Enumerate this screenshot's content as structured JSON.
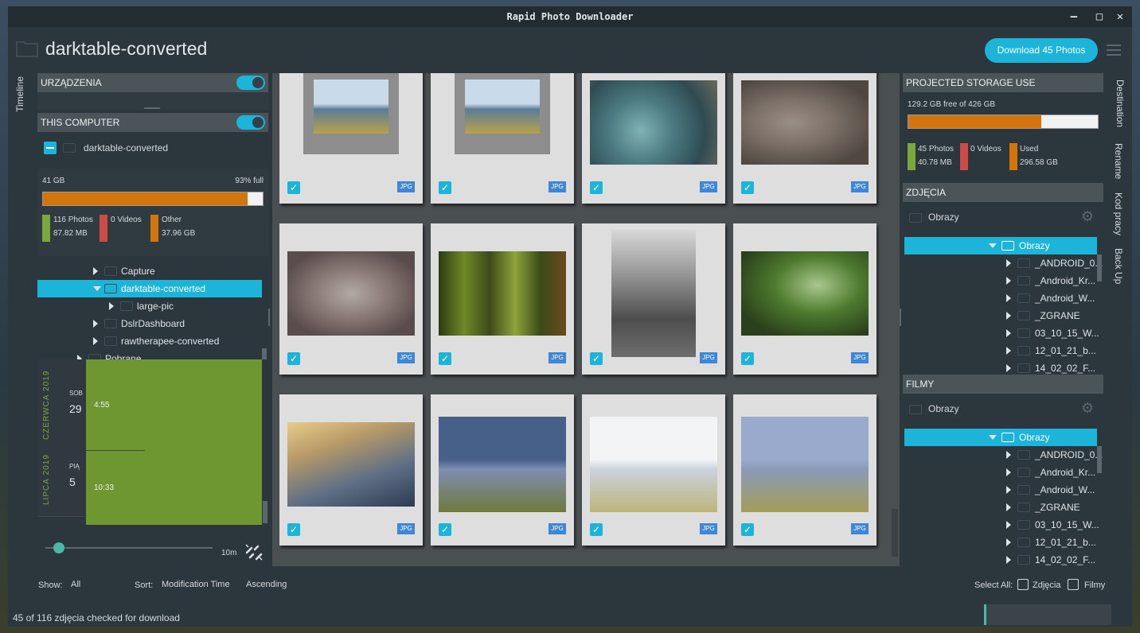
{
  "window": {
    "title": "Rapid Photo Downloader"
  },
  "header": {
    "title": "darktable-converted",
    "download_button": "Download 45 Photos"
  },
  "left_tabs": {
    "timeline": "Timeline"
  },
  "devices": {
    "label": "URZĄDZENIA"
  },
  "this_computer": {
    "label": "THIS COMPUTER",
    "folder": "darktable-converted",
    "storage_size": "41 GB",
    "storage_full": "93% full",
    "used_fraction": 0.93,
    "legend": [
      {
        "label": "116 Photos",
        "value": "87.82 MB",
        "color": "#7aa83d"
      },
      {
        "label": "0 Videos",
        "value": "",
        "color": "#cc4b46"
      },
      {
        "label": "Other",
        "value": "37.96 GB",
        "color": "#d4740d"
      }
    ],
    "tree": [
      {
        "label": "Capture",
        "selected": false
      },
      {
        "label": "darktable-converted",
        "selected": true
      },
      {
        "label": "large-pic",
        "selected": false
      },
      {
        "label": "DslrDashboard",
        "selected": false
      },
      {
        "label": "rawtherapee-converted",
        "selected": false
      },
      {
        "label": "Pobrane",
        "selected": false
      }
    ]
  },
  "timeline": {
    "groups": [
      {
        "month": "CZERWCA",
        "year": "2019",
        "weekday": "SOB",
        "day": "29",
        "time": "4:55"
      },
      {
        "month": "LIPCA",
        "year": "2019",
        "weekday": "PIĄ",
        "day": "5",
        "time": "10:33"
      }
    ],
    "slider_value": "10m"
  },
  "thumbnails": [
    {
      "type": "JPG",
      "checked": true
    },
    {
      "type": "JPG",
      "checked": true
    },
    {
      "type": "JPG",
      "checked": true
    },
    {
      "type": "JPG",
      "checked": true
    },
    {
      "type": "JPG",
      "checked": true
    },
    {
      "type": "JPG",
      "checked": true
    },
    {
      "type": "JPG",
      "checked": true
    },
    {
      "type": "JPG",
      "checked": true
    },
    {
      "type": "JPG",
      "checked": true
    },
    {
      "type": "JPG",
      "checked": true
    },
    {
      "type": "JPG",
      "checked": true
    },
    {
      "type": "JPG",
      "checked": true
    }
  ],
  "projected": {
    "label": "PROJECTED STORAGE USE",
    "free_text": "129.2 GB free of 426 GB",
    "used_fraction": 0.7,
    "legend": [
      {
        "label": "45 Photos",
        "value": "40.78 MB",
        "color": "#7aa83d"
      },
      {
        "label": "0 Videos",
        "value": "",
        "color": "#cc4b46"
      },
      {
        "label": "Used",
        "value": "296.58 GB",
        "color": "#d4740d"
      }
    ]
  },
  "photos_dest": {
    "label": "ZDJĘCIA",
    "folder": "Obrazy",
    "tree_root": "Obrazy",
    "tree": [
      "_ANDROID_0...",
      "_Android_Kr...",
      "_Android_W...",
      "_ZGRANE",
      "03_10_15_W...",
      "12_01_21_b...",
      "14_02_02_F..."
    ]
  },
  "videos_dest": {
    "label": "FILMY",
    "folder": "Obrazy",
    "tree_root": "Obrazy",
    "tree": [
      "_ANDROID_0...",
      "_Android_Kr...",
      "_Android_W...",
      "_ZGRANE",
      "03_10_15_W...",
      "12_01_21_b...",
      "14_02_02_F..."
    ]
  },
  "right_tabs": [
    "Destination",
    "Rename",
    "Kod pracy",
    "Back Up"
  ],
  "bottom": {
    "show_label": "Show:",
    "show_value": "All",
    "sort_label": "Sort:",
    "sort_value": "Modification Time",
    "order_value": "Ascending",
    "select_all_label": "Select All:",
    "select_photos": "Zdjęcia",
    "select_videos": "Filmy",
    "status": "45 of 116 zdjęcia checked for download"
  }
}
